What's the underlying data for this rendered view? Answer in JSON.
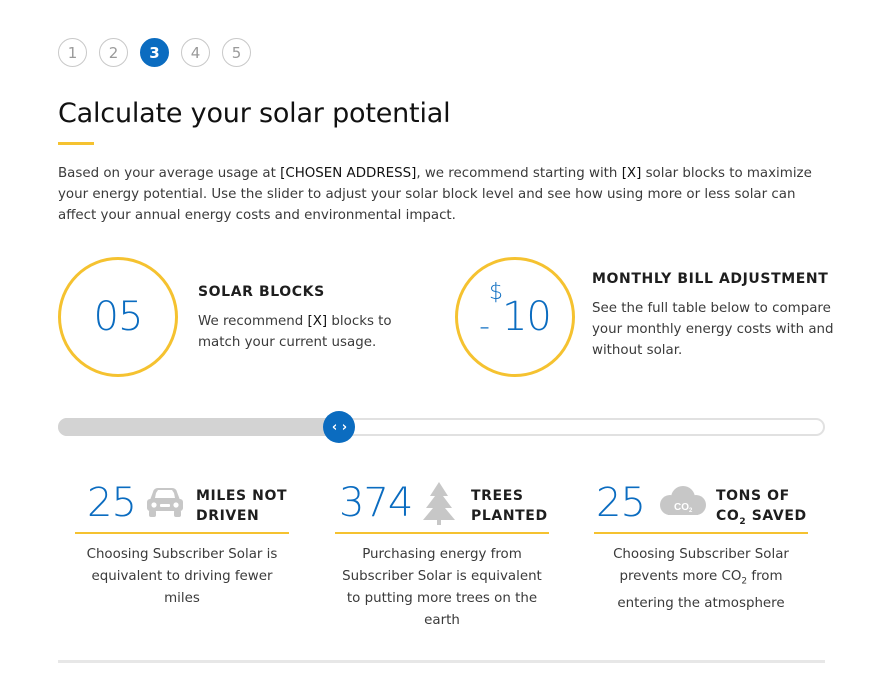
{
  "steps": [
    {
      "label": "1",
      "active": false
    },
    {
      "label": "2",
      "active": false
    },
    {
      "label": "3",
      "active": true
    },
    {
      "label": "4",
      "active": false
    },
    {
      "label": "5",
      "active": false
    }
  ],
  "title": "Calculate your solar potential",
  "intro": {
    "part1": "Based on your average usage at ",
    "address": "[CHOSEN ADDRESS]",
    "part2": ", we recommend starting with ",
    "blocks": "[X]",
    "part3": " solar blocks to maximize your energy potential. Use the slider to adjust your solar block level and see how using more or less solar can affect your annual energy costs and environmental impact."
  },
  "solar_blocks": {
    "value": "05",
    "title": "SOLAR BLOCKS",
    "text_part1": "We recommend ",
    "text_placeholder": "[X]",
    "text_part2": " blocks to match your current usage."
  },
  "bill": {
    "sign": "-",
    "currency": "$",
    "amount": "10",
    "title": "MONTHLY BILL ADJUSTMENT",
    "text": "See the full table below to compare your monthly energy costs with and without solar."
  },
  "slider": {
    "level": 0.367,
    "thumb_glyph": "‹ ›"
  },
  "stats": {
    "miles": {
      "value": "25",
      "label_line1": "MILES NOT",
      "label_line2": "DRIVEN",
      "icon": "car-icon",
      "desc": "Choosing Subscriber Solar is equivalent to driving fewer miles"
    },
    "trees": {
      "value": "374",
      "label_line1": "TREES",
      "label_line2": "PLANTED",
      "icon": "tree-icon",
      "desc": "Purchasing energy from Subscriber Solar is equivalent to putting more trees on the earth"
    },
    "co2": {
      "value": "25",
      "label_line1": "TONS OF",
      "label_line2_a": "CO",
      "label_line2_sub": "2",
      "label_line2_b": " SAVED",
      "icon": "co2-cloud-icon",
      "cloud_text": "CO",
      "cloud_sub": "2",
      "desc_part1": "Choosing Subscriber Solar prevents more CO",
      "desc_sub": "2",
      "desc_part2": " from entering the atmosphere"
    }
  },
  "colors": {
    "accent_blue": "#0b6cc0",
    "accent_yellow": "#f5c230",
    "icon_gray": "#c7c7c7"
  }
}
